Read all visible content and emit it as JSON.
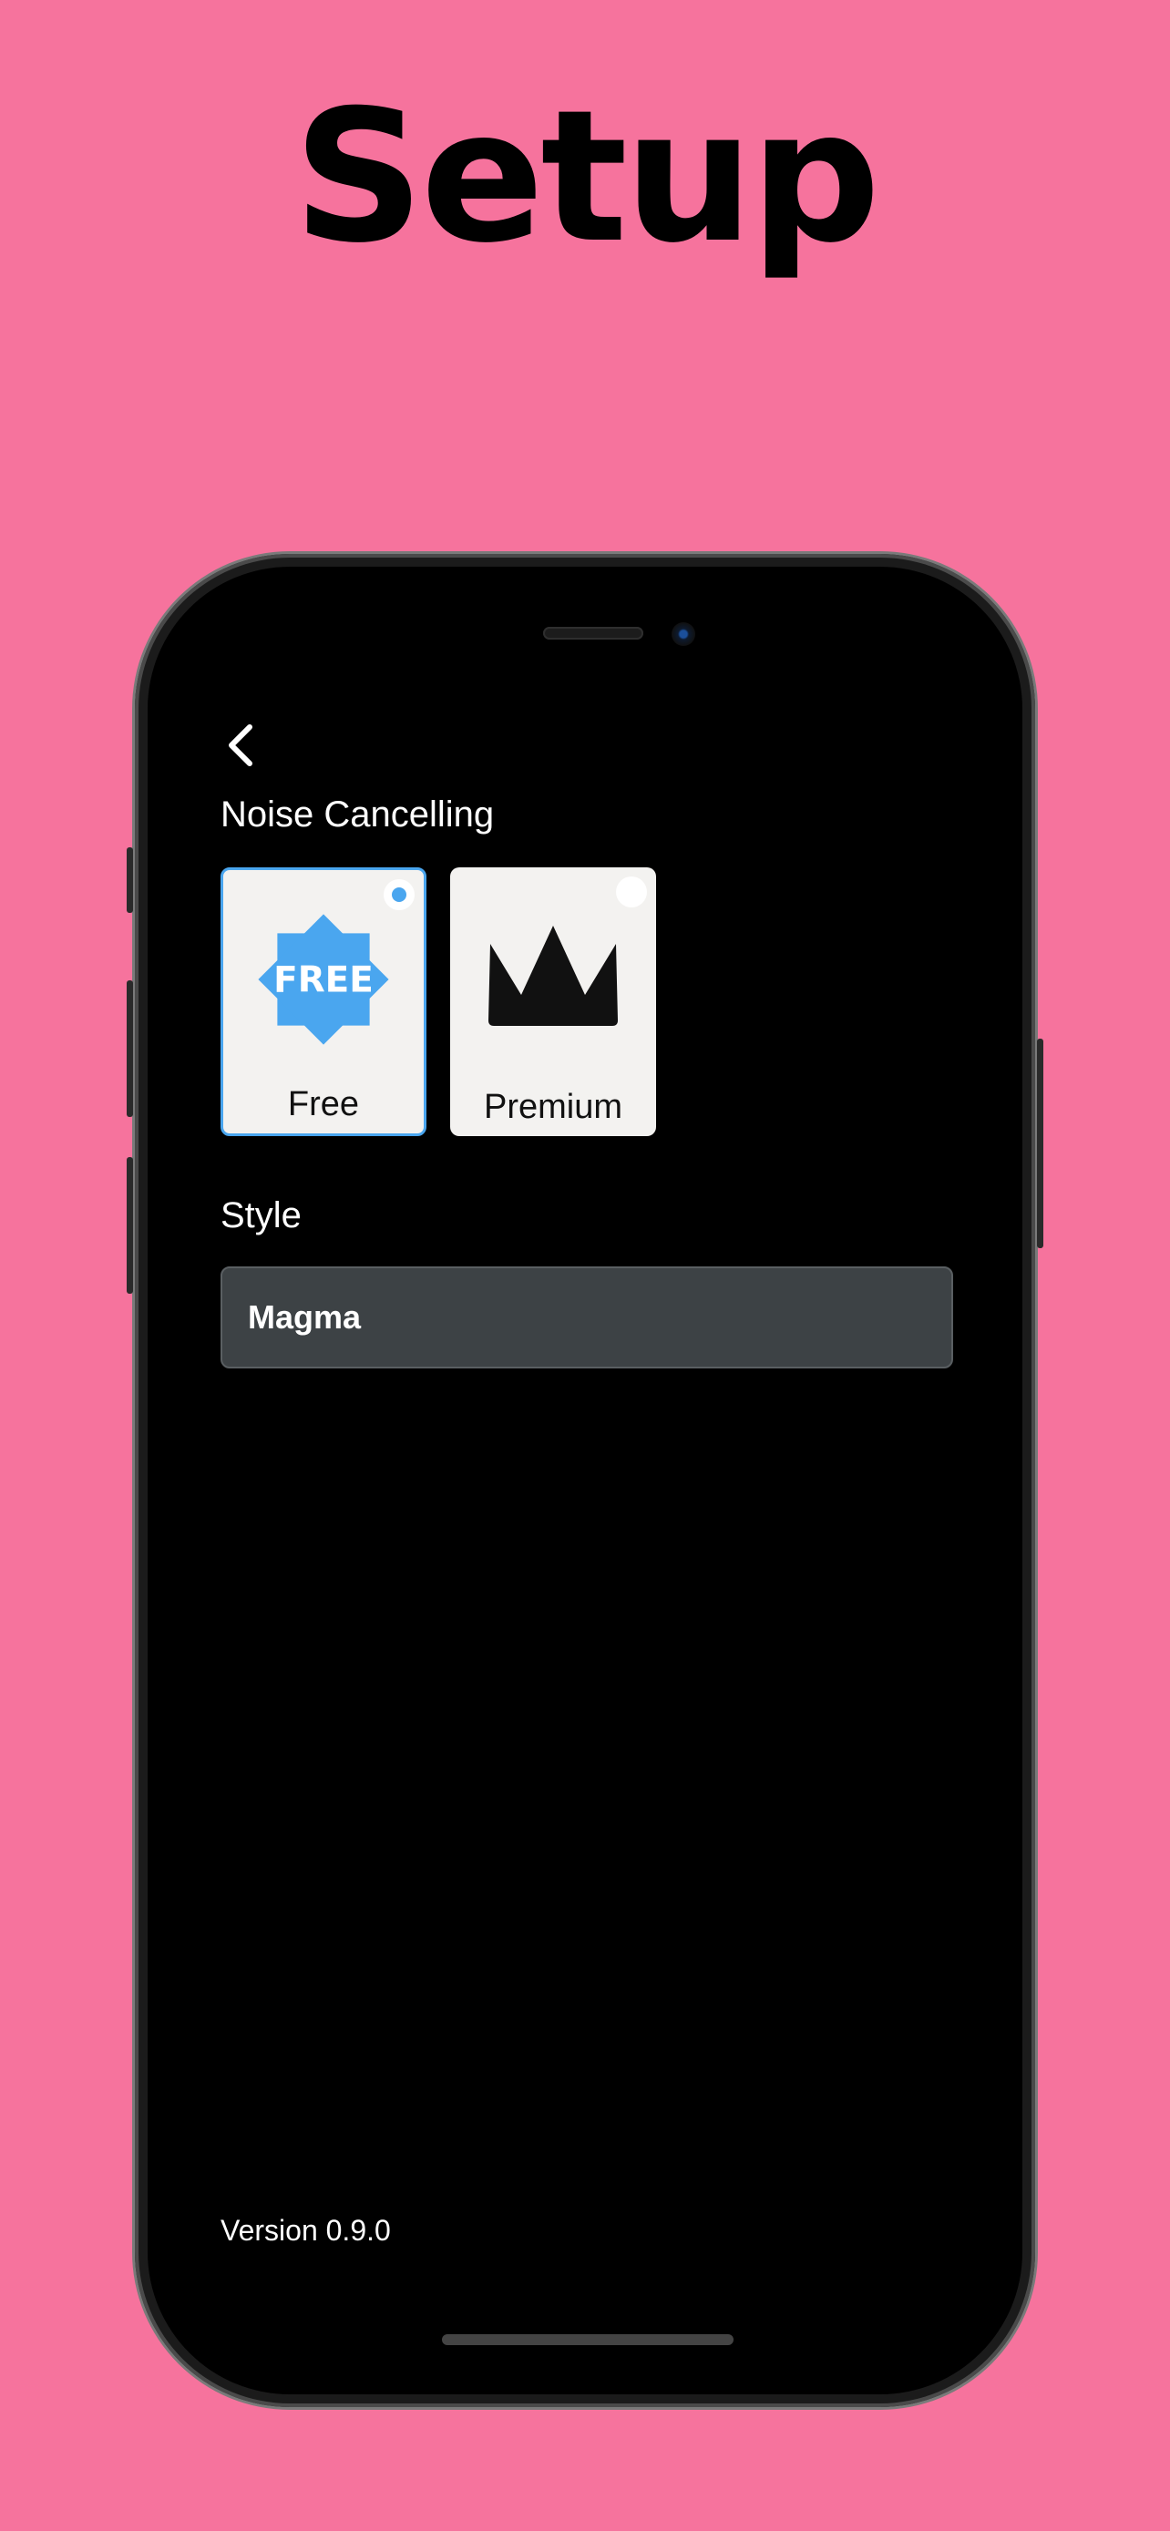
{
  "headline": "Setup",
  "back_icon": "chevron-left-icon",
  "noise_cancelling": {
    "label": "Noise Cancelling",
    "options": [
      {
        "label": "Free",
        "badge_text": "FREE",
        "icon": "free-badge-icon",
        "selected": true
      },
      {
        "label": "Premium",
        "icon": "crown-icon",
        "selected": false
      }
    ]
  },
  "style": {
    "label": "Style",
    "value": "Magma"
  },
  "version": "Version 0.9.0",
  "colors": {
    "background": "#f6739d",
    "accent": "#4aa6ef",
    "card": "#f3f2f0",
    "select_bg": "#3d4245"
  }
}
